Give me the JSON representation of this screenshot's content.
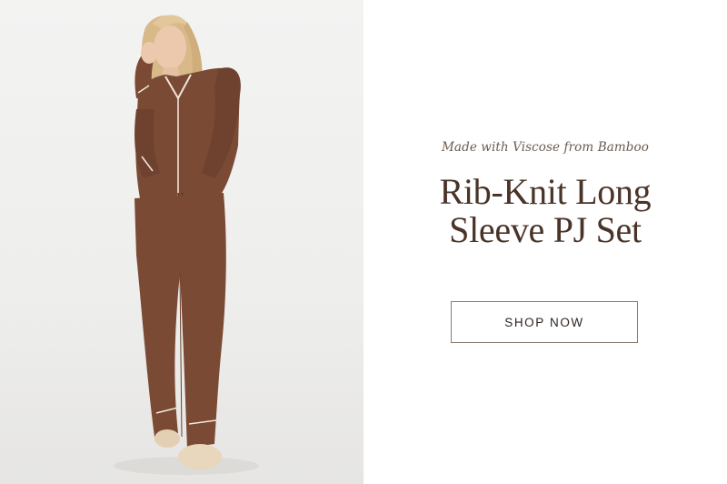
{
  "hero": {
    "image_alt": "Woman wearing brown rib-knit long sleeve pajama set",
    "eyebrow": "Made with Viscose from Bamboo",
    "title_line1": "Rib-Knit Long",
    "title_line2": "Sleeve PJ Set",
    "cta_label": "SHOP NOW"
  },
  "colors": {
    "title": "#4a3428",
    "eyebrow": "#6b5a4e",
    "garment": "#7a4a34",
    "piping": "#f1e6da"
  }
}
